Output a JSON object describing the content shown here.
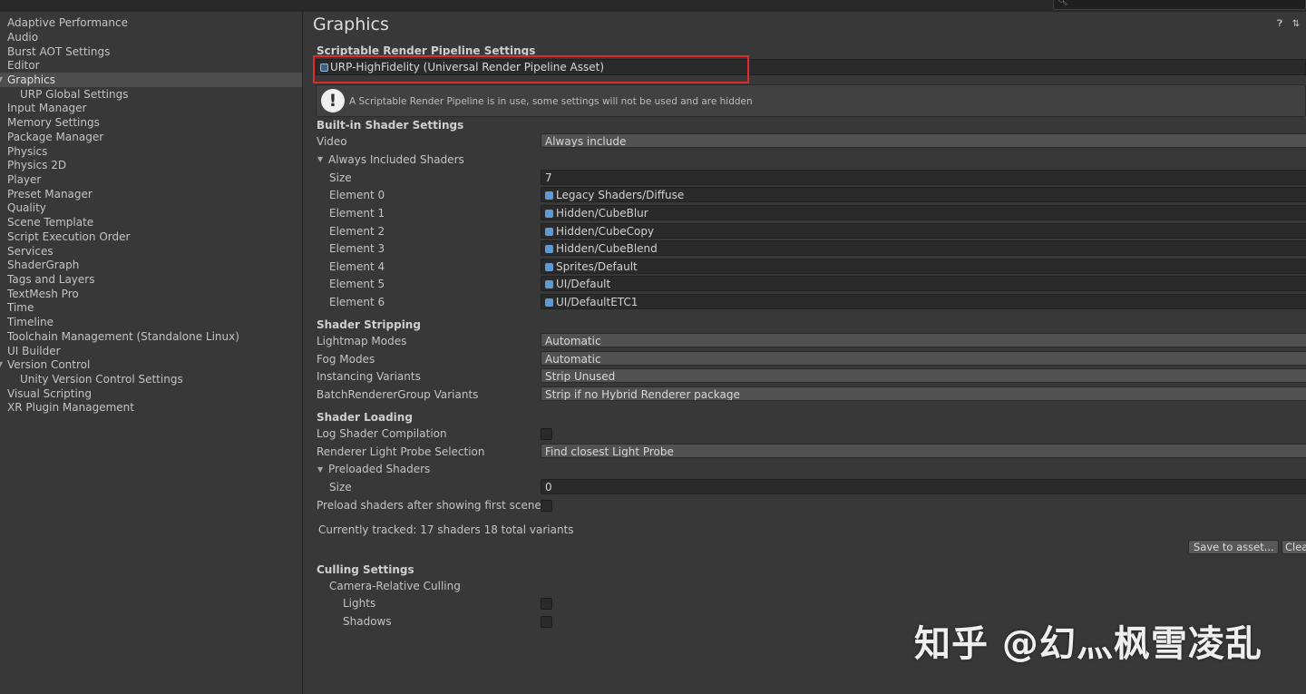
{
  "search": {
    "placeholder": ""
  },
  "sidebar": {
    "items": [
      {
        "label": "Adaptive Performance"
      },
      {
        "label": "Audio"
      },
      {
        "label": "Burst AOT Settings"
      },
      {
        "label": "Editor"
      },
      {
        "label": "Graphics"
      },
      {
        "label": "URP Global Settings"
      },
      {
        "label": "Input Manager"
      },
      {
        "label": "Memory Settings"
      },
      {
        "label": "Package Manager"
      },
      {
        "label": "Physics"
      },
      {
        "label": "Physics 2D"
      },
      {
        "label": "Player"
      },
      {
        "label": "Preset Manager"
      },
      {
        "label": "Quality"
      },
      {
        "label": "Scene Template"
      },
      {
        "label": "Script Execution Order"
      },
      {
        "label": "Services"
      },
      {
        "label": "ShaderGraph"
      },
      {
        "label": "Tags and Layers"
      },
      {
        "label": "TextMesh Pro"
      },
      {
        "label": "Time"
      },
      {
        "label": "Timeline"
      },
      {
        "label": "Toolchain Management (Standalone Linux)"
      },
      {
        "label": "UI Builder"
      },
      {
        "label": "Version Control"
      },
      {
        "label": "Unity Version Control Settings"
      },
      {
        "label": "Visual Scripting"
      },
      {
        "label": "XR Plugin Management"
      }
    ]
  },
  "main": {
    "title": "Graphics",
    "help_icon": "help-icon",
    "preset_icon": "preset-icon",
    "srp": {
      "heading": "Scriptable Render Pipeline Settings",
      "value": "URP-HighFidelity (Universal Render Pipeline Asset)",
      "help_text": "A Scriptable Render Pipeline is in use, some settings will not be used and are hidden"
    },
    "builtin": {
      "heading": "Built-in Shader Settings",
      "video_label": "Video",
      "video_value": "Always include",
      "always_included_label": "Always Included Shaders",
      "size_label": "Size",
      "size_value": "7",
      "elements": [
        {
          "label": "Element 0",
          "value": "Legacy Shaders/Diffuse"
        },
        {
          "label": "Element 1",
          "value": "Hidden/CubeBlur"
        },
        {
          "label": "Element 2",
          "value": "Hidden/CubeCopy"
        },
        {
          "label": "Element 3",
          "value": "Hidden/CubeBlend"
        },
        {
          "label": "Element 4",
          "value": "Sprites/Default"
        },
        {
          "label": "Element 5",
          "value": "UI/Default"
        },
        {
          "label": "Element 6",
          "value": "UI/DefaultETC1"
        }
      ]
    },
    "stripping": {
      "heading": "Shader Stripping",
      "rows": [
        {
          "label": "Lightmap Modes",
          "value": "Automatic"
        },
        {
          "label": "Fog Modes",
          "value": "Automatic"
        },
        {
          "label": "Instancing Variants",
          "value": "Strip Unused"
        },
        {
          "label": "BatchRendererGroup Variants",
          "value": "Strip if no Hybrid Renderer package"
        }
      ]
    },
    "loading": {
      "heading": "Shader Loading",
      "log_label": "Log Shader Compilation",
      "probe_label": "Renderer Light Probe Selection",
      "probe_value": "Find closest Light Probe",
      "preloaded_label": "Preloaded Shaders",
      "size_label": "Size",
      "size_value": "0",
      "preload_after_label": "Preload shaders after showing first scene",
      "tracked_text": "Currently tracked: 17 shaders 18 total variants",
      "save_button": "Save to asset...",
      "clear_button": "Clear"
    },
    "culling": {
      "heading": "Culling Settings",
      "camera_relative_label": "Camera-Relative Culling",
      "lights_label": "Lights",
      "shadows_label": "Shadows"
    }
  },
  "watermark": "知乎 @幻灬枫雪凌乱"
}
